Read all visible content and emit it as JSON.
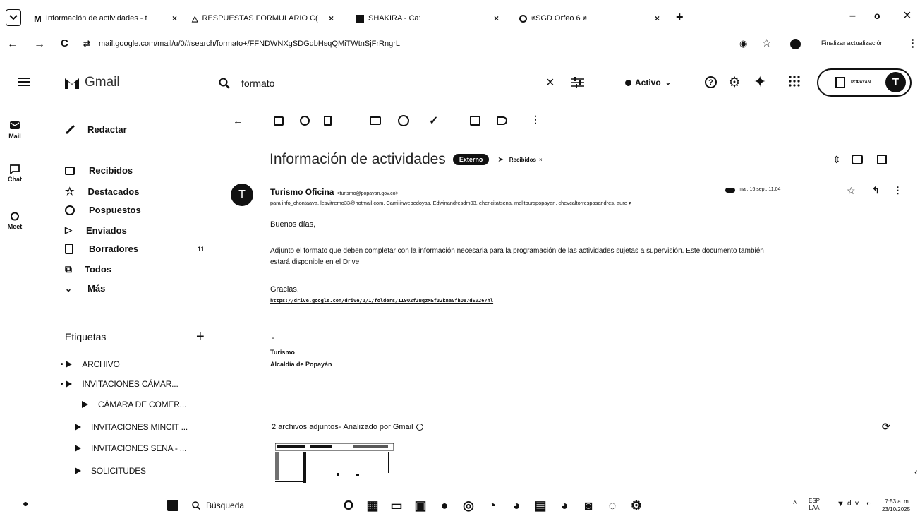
{
  "browser": {
    "tabs": [
      {
        "title": "Información de actividades - t",
        "icon": "gmail-icon",
        "active": true
      },
      {
        "title": "RESPUESTAS FORMULARIO C(",
        "icon": "drive-icon"
      },
      {
        "title": "SHAKIRA - Ca:",
        "icon": "youtube-icon"
      },
      {
        "title": "≠SGD Orfeo 6 ≠",
        "icon": "orfeo-icon"
      }
    ],
    "new_tab": "+",
    "url": "mail.google.com/mail/u/0/#search/formato+/FFNDWNXgSDGdbHsqQMiTWtnSjFrRngrL",
    "update_button": "Finalizar actualización",
    "window_min": "–",
    "window_max": "o",
    "window_close": "×"
  },
  "gmail": {
    "product": "Gmail",
    "search_query": "formato",
    "status": "Activo",
    "account_chip": "POPAYAN",
    "avatar_letter": "T",
    "rail": [
      {
        "label": "Mail",
        "icon": "mail-icon"
      },
      {
        "label": "Chat",
        "icon": "chat-icon"
      },
      {
        "label": "Meet",
        "icon": "meet-icon"
      }
    ],
    "compose": "Redactar",
    "nav": [
      {
        "label": "Recibidos",
        "icon": "inbox-icon",
        "count": ""
      },
      {
        "label": "Destacados",
        "icon": "star-icon",
        "count": ""
      },
      {
        "label": "Pospuestos",
        "icon": "clock-icon",
        "count": ""
      },
      {
        "label": "Enviados",
        "icon": "send-icon",
        "count": ""
      },
      {
        "label": "Borradores",
        "icon": "draft-icon",
        "count": "11"
      },
      {
        "label": "Todos",
        "icon": "all-mail-icon",
        "count": ""
      },
      {
        "label": "Más",
        "icon": "chevron-down-icon",
        "count": ""
      }
    ],
    "labels_title": "Etiquetas",
    "labels_add": "+",
    "labels": [
      {
        "name": "ARCHIVO",
        "indent": 0,
        "expander": true
      },
      {
        "name": "INVITACIONES CÁMAR...",
        "indent": 0,
        "expander": true
      },
      {
        "name": "CÁMARA DE COMER...",
        "indent": 1,
        "expander": false
      },
      {
        "name": "INVITACIONES MINCIT ...",
        "indent": 0,
        "expander": false
      },
      {
        "name": "INVITACIONES SENA - ...",
        "indent": 0,
        "expander": false
      },
      {
        "name": "SOLICITUDES",
        "indent": 0,
        "expander": false
      }
    ]
  },
  "message": {
    "subject": "Información de actividades",
    "badge": "Externo",
    "folder": "Recibidos",
    "sender_initial": "T",
    "sender_name": "Turismo Oficina",
    "sender_email": "<turismo@popayan.gov.co>",
    "date": "mar, 16 sept, 11:04",
    "recipients": "para info_chontaava, lesvitremo33@hotmail.com, Camilinwebedoyas, Edwinandresdm03, ehericitatsena, melitourspopayan, chevcaltorrespasandres, aure",
    "greeting": "Buenos días,",
    "body_line1": "Adjunto el formato que deben completar con la información necesaria para la programación de las actividades sujetas a supervisión. Este documento también",
    "body_line2": "estará disponible en el Drive",
    "thanks": "Gracias,",
    "link": "https://drive.google.com/drive/u/1/folders/1I9O2f3BqzMEf32knaGfhO87dSv267hl",
    "dash": "-",
    "signature_name": "Turismo",
    "signature_org": "Alcaldía de Popayán",
    "attachments_heading": "2 archivos adjuntos",
    "attachments_scan": "Analizado por Gmail"
  },
  "taskbar": {
    "search_label": "Búsqueda",
    "language": "ESP",
    "language_sub": "LAA",
    "time": "7:53 a. m.",
    "date": "23/10/2025",
    "apps": [
      "opera-icon",
      "teams-icon",
      "files-icon",
      "outlook-icon",
      "photo-icon",
      "spotify-icon",
      "chrome-icon",
      "chrome-profile-icon",
      "word-icon",
      "chrome-alt-icon",
      "shield-icon",
      "edge-icon",
      "settings-icon"
    ]
  }
}
